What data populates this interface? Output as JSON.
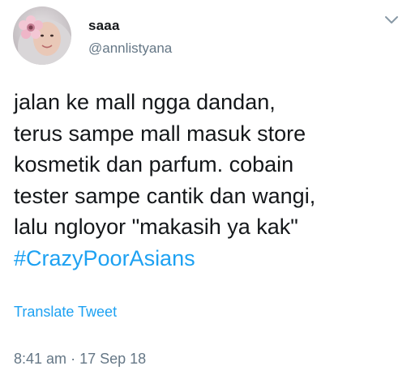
{
  "user": {
    "display_name": "saaa",
    "handle": "@annlistyana",
    "avatar_icon": "profile-photo-with-flower"
  },
  "tweet": {
    "lines": [
      "jalan ke mall ngga dandan,",
      "terus sampe mall masuk store",
      "kosmetik dan parfum. cobain",
      "tester sampe cantik dan wangi,",
      "lalu ngloyor \"makasih ya kak\""
    ],
    "hashtag": "#CrazyPoorAsians"
  },
  "actions": {
    "translate_label": "Translate Tweet",
    "menu_icon": "chevron-down-icon"
  },
  "meta": {
    "time": "8:41 am",
    "separator": "·",
    "date": "17 Sep 18"
  },
  "colors": {
    "text": "#14171a",
    "secondary": "#657786",
    "link": "#1da1f2",
    "background": "#ffffff"
  }
}
